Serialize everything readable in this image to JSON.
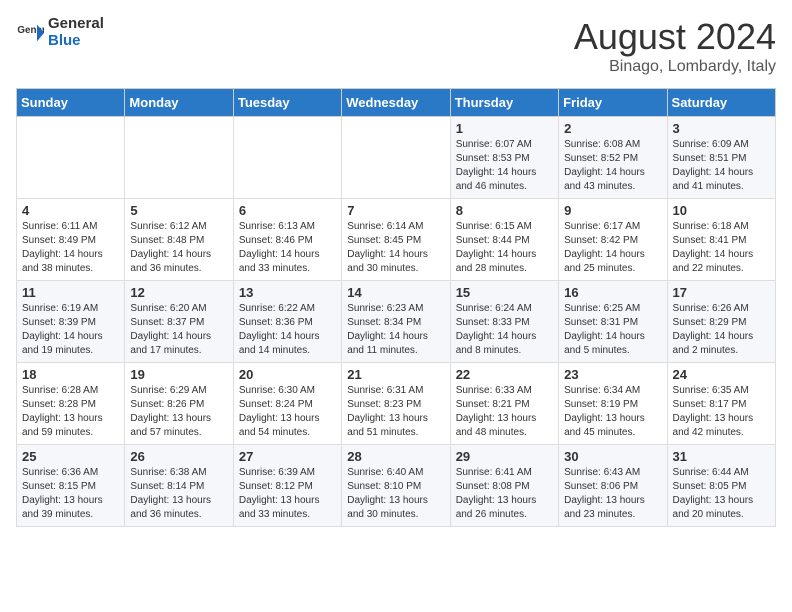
{
  "header": {
    "logo_general": "General",
    "logo_blue": "Blue",
    "month_year": "August 2024",
    "location": "Binago, Lombardy, Italy"
  },
  "weekdays": [
    "Sunday",
    "Monday",
    "Tuesday",
    "Wednesday",
    "Thursday",
    "Friday",
    "Saturday"
  ],
  "weeks": [
    [
      {
        "day": "",
        "info": ""
      },
      {
        "day": "",
        "info": ""
      },
      {
        "day": "",
        "info": ""
      },
      {
        "day": "",
        "info": ""
      },
      {
        "day": "1",
        "info": "Sunrise: 6:07 AM\nSunset: 8:53 PM\nDaylight: 14 hours\nand 46 minutes."
      },
      {
        "day": "2",
        "info": "Sunrise: 6:08 AM\nSunset: 8:52 PM\nDaylight: 14 hours\nand 43 minutes."
      },
      {
        "day": "3",
        "info": "Sunrise: 6:09 AM\nSunset: 8:51 PM\nDaylight: 14 hours\nand 41 minutes."
      }
    ],
    [
      {
        "day": "4",
        "info": "Sunrise: 6:11 AM\nSunset: 8:49 PM\nDaylight: 14 hours\nand 38 minutes."
      },
      {
        "day": "5",
        "info": "Sunrise: 6:12 AM\nSunset: 8:48 PM\nDaylight: 14 hours\nand 36 minutes."
      },
      {
        "day": "6",
        "info": "Sunrise: 6:13 AM\nSunset: 8:46 PM\nDaylight: 14 hours\nand 33 minutes."
      },
      {
        "day": "7",
        "info": "Sunrise: 6:14 AM\nSunset: 8:45 PM\nDaylight: 14 hours\nand 30 minutes."
      },
      {
        "day": "8",
        "info": "Sunrise: 6:15 AM\nSunset: 8:44 PM\nDaylight: 14 hours\nand 28 minutes."
      },
      {
        "day": "9",
        "info": "Sunrise: 6:17 AM\nSunset: 8:42 PM\nDaylight: 14 hours\nand 25 minutes."
      },
      {
        "day": "10",
        "info": "Sunrise: 6:18 AM\nSunset: 8:41 PM\nDaylight: 14 hours\nand 22 minutes."
      }
    ],
    [
      {
        "day": "11",
        "info": "Sunrise: 6:19 AM\nSunset: 8:39 PM\nDaylight: 14 hours\nand 19 minutes."
      },
      {
        "day": "12",
        "info": "Sunrise: 6:20 AM\nSunset: 8:37 PM\nDaylight: 14 hours\nand 17 minutes."
      },
      {
        "day": "13",
        "info": "Sunrise: 6:22 AM\nSunset: 8:36 PM\nDaylight: 14 hours\nand 14 minutes."
      },
      {
        "day": "14",
        "info": "Sunrise: 6:23 AM\nSunset: 8:34 PM\nDaylight: 14 hours\nand 11 minutes."
      },
      {
        "day": "15",
        "info": "Sunrise: 6:24 AM\nSunset: 8:33 PM\nDaylight: 14 hours\nand 8 minutes."
      },
      {
        "day": "16",
        "info": "Sunrise: 6:25 AM\nSunset: 8:31 PM\nDaylight: 14 hours\nand 5 minutes."
      },
      {
        "day": "17",
        "info": "Sunrise: 6:26 AM\nSunset: 8:29 PM\nDaylight: 14 hours\nand 2 minutes."
      }
    ],
    [
      {
        "day": "18",
        "info": "Sunrise: 6:28 AM\nSunset: 8:28 PM\nDaylight: 13 hours\nand 59 minutes."
      },
      {
        "day": "19",
        "info": "Sunrise: 6:29 AM\nSunset: 8:26 PM\nDaylight: 13 hours\nand 57 minutes."
      },
      {
        "day": "20",
        "info": "Sunrise: 6:30 AM\nSunset: 8:24 PM\nDaylight: 13 hours\nand 54 minutes."
      },
      {
        "day": "21",
        "info": "Sunrise: 6:31 AM\nSunset: 8:23 PM\nDaylight: 13 hours\nand 51 minutes."
      },
      {
        "day": "22",
        "info": "Sunrise: 6:33 AM\nSunset: 8:21 PM\nDaylight: 13 hours\nand 48 minutes."
      },
      {
        "day": "23",
        "info": "Sunrise: 6:34 AM\nSunset: 8:19 PM\nDaylight: 13 hours\nand 45 minutes."
      },
      {
        "day": "24",
        "info": "Sunrise: 6:35 AM\nSunset: 8:17 PM\nDaylight: 13 hours\nand 42 minutes."
      }
    ],
    [
      {
        "day": "25",
        "info": "Sunrise: 6:36 AM\nSunset: 8:15 PM\nDaylight: 13 hours\nand 39 minutes."
      },
      {
        "day": "26",
        "info": "Sunrise: 6:38 AM\nSunset: 8:14 PM\nDaylight: 13 hours\nand 36 minutes."
      },
      {
        "day": "27",
        "info": "Sunrise: 6:39 AM\nSunset: 8:12 PM\nDaylight: 13 hours\nand 33 minutes."
      },
      {
        "day": "28",
        "info": "Sunrise: 6:40 AM\nSunset: 8:10 PM\nDaylight: 13 hours\nand 30 minutes."
      },
      {
        "day": "29",
        "info": "Sunrise: 6:41 AM\nSunset: 8:08 PM\nDaylight: 13 hours\nand 26 minutes."
      },
      {
        "day": "30",
        "info": "Sunrise: 6:43 AM\nSunset: 8:06 PM\nDaylight: 13 hours\nand 23 minutes."
      },
      {
        "day": "31",
        "info": "Sunrise: 6:44 AM\nSunset: 8:05 PM\nDaylight: 13 hours\nand 20 minutes."
      }
    ]
  ]
}
